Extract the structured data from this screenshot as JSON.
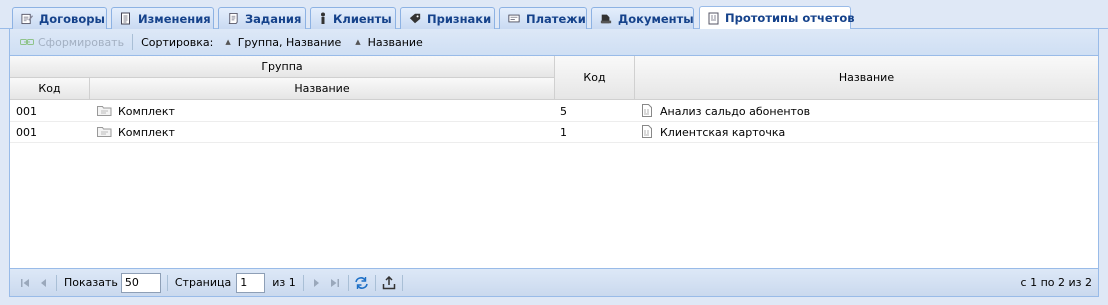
{
  "tabs": [
    {
      "label": "Договоры",
      "icon": "contract-edit-icon"
    },
    {
      "label": "Изменения",
      "icon": "document-list-icon"
    },
    {
      "label": "Задания",
      "icon": "task-scroll-icon"
    },
    {
      "label": "Клиенты",
      "icon": "person-icon"
    },
    {
      "label": "Признаки",
      "icon": "tag-icon"
    },
    {
      "label": "Платежи",
      "icon": "payment-card-icon"
    },
    {
      "label": "Документы",
      "icon": "documents-stack-icon"
    },
    {
      "label": "Прототипы отчетов",
      "icon": "report-prototype-icon",
      "active": true
    }
  ],
  "toolbar": {
    "generate_label": "Сформировать",
    "sort_label": "Сортировка:",
    "sort_group_label": "Группа, Название",
    "sort_name_label": "Название"
  },
  "grid": {
    "group_header": "Группа",
    "group_code_header": "Код",
    "group_name_header": "Название",
    "code_header": "Код",
    "name_header": "Название",
    "rows": [
      {
        "group_code": "001",
        "group_name": "Комплект",
        "code": "5",
        "name": "Анализ сальдо абонентов"
      },
      {
        "group_code": "001",
        "group_name": "Комплект",
        "code": "1",
        "name": "Клиентская карточка"
      }
    ]
  },
  "pager": {
    "show_label": "Показать",
    "page_size": "50",
    "page_label": "Страница",
    "page": "1",
    "of_label": "из 1",
    "info": "с 1 по 2 из 2"
  },
  "colors": {
    "accent": "#15428b",
    "border": "#99bbe8",
    "background": "#dfe8f6"
  }
}
